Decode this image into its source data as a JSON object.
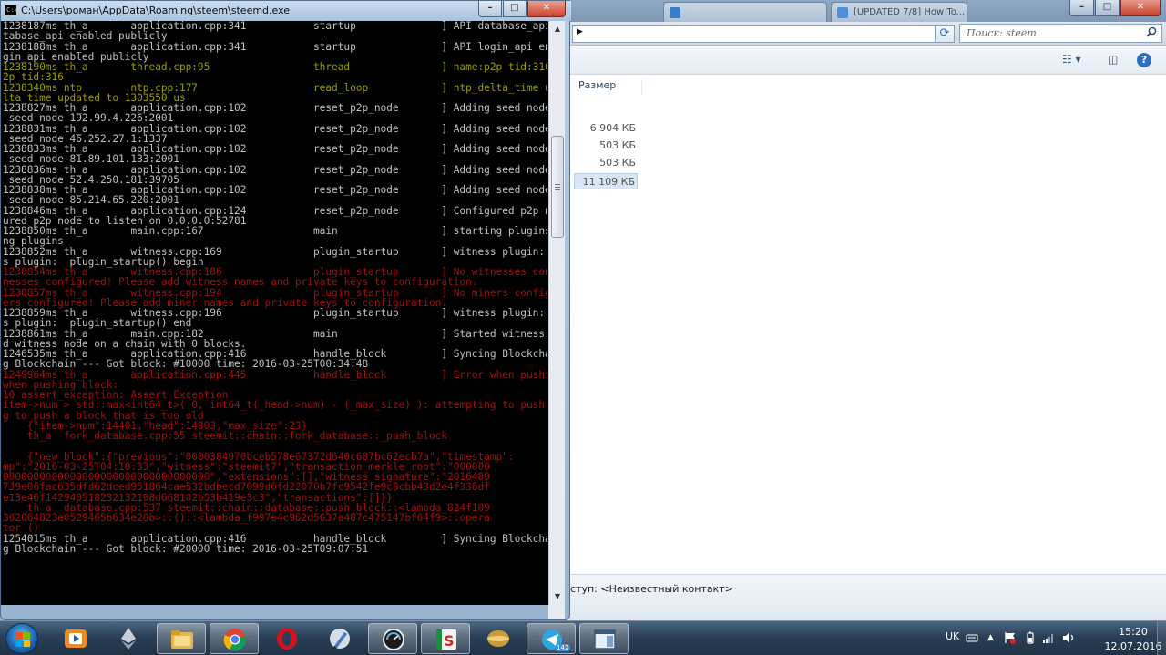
{
  "console": {
    "title": "C:\\Users\\роман\\AppData\\Roaming\\steem\\steemd.exe",
    "buttons": {
      "minimize": "–",
      "maximize": "□",
      "close": "✕"
    },
    "lines": [
      {
        "c": "grey",
        "t": "1238187ms th_a       application.cpp:341           startup              ] API database_api enabled publicly"
      },
      {
        "c": "grey",
        "t": "tabase_api enabled publicly"
      },
      {
        "c": "grey",
        "t": "1238188ms th_a       application.cpp:341           startup              ] API login_api enabled publicly"
      },
      {
        "c": "grey",
        "t": "gin_api enabled publicly"
      },
      {
        "c": "yellow",
        "t": "1238190ms th_a       thread.cpp:95                 thread               ] name:p2p tid:316"
      },
      {
        "c": "yellow",
        "t": "2p tid:316"
      },
      {
        "c": "yellow",
        "t": "1238340ms ntp        ntp.cpp:177                   read_loop            ] ntp_delta_time updated to 1303550 us"
      },
      {
        "c": "yellow",
        "t": "lta_time updated to 1303550 us"
      },
      {
        "c": "grey",
        "t": "1238827ms th_a       application.cpp:102           reset_p2p_node       ] Adding seed node 192.99.4.226:2001"
      },
      {
        "c": "grey",
        "t": " seed node 192.99.4.226:2001"
      },
      {
        "c": "grey",
        "t": "1238831ms th_a       application.cpp:102           reset_p2p_node       ] Adding seed node 46.252.27.1:1337"
      },
      {
        "c": "grey",
        "t": " seed node 46.252.27.1:1337"
      },
      {
        "c": "grey",
        "t": "1238833ms th_a       application.cpp:102           reset_p2p_node       ] Adding seed node 81.89.101.133:2001"
      },
      {
        "c": "grey",
        "t": " seed node 81.89.101.133:2001"
      },
      {
        "c": "grey",
        "t": "1238836ms th_a       application.cpp:102           reset_p2p_node       ] Adding seed node 52.4.250.181:39705"
      },
      {
        "c": "grey",
        "t": " seed node 52.4.250.181:39705"
      },
      {
        "c": "grey",
        "t": "1238838ms th_a       application.cpp:102           reset_p2p_node       ] Adding seed node 85.214.65.220:2001"
      },
      {
        "c": "grey",
        "t": " seed node 85.214.65.220:2001"
      },
      {
        "c": "grey",
        "t": "1238846ms th_a       application.cpp:124           reset_p2p_node       ] Configured p2p node to listen on 0.0.0.0:52781"
      },
      {
        "c": "grey",
        "t": "ured p2p node to listen on 0.0.0.0:52781"
      },
      {
        "c": "grey",
        "t": "1238850ms th_a       main.cpp:167                  main                 ] starting plugins"
      },
      {
        "c": "grey",
        "t": "ng plugins"
      },
      {
        "c": "grey",
        "t": "1238852ms th_a       witness.cpp:169               plugin_startup       ] witness plugin:  plugin_startup() begin"
      },
      {
        "c": "grey",
        "t": "s plugin:  plugin_startup() begin"
      },
      {
        "c": "red",
        "t": "1238854ms th_a       witness.cpp:186               plugin_startup       ] No witnesses configured! Please add witness names and private keys to configuration."
      },
      {
        "c": "red",
        "t": "nesses configured! Please add witness names and private keys to configuration."
      },
      {
        "c": "red",
        "t": "1238857ms th_a       witness.cpp:194               plugin_startup       ] No miners configured! Please add miner names and private keys to configuration."
      },
      {
        "c": "red",
        "t": "ers configured! Please add miner names and private keys to configuration."
      },
      {
        "c": "grey",
        "t": "1238859ms th_a       witness.cpp:196               plugin_startup       ] witness plugin:  plugin_startup() end"
      },
      {
        "c": "grey",
        "t": "s plugin:  plugin_startup() end"
      },
      {
        "c": "grey",
        "t": "1238861ms th_a       main.cpp:182                  main                 ] Started witness node on a chain with 0 blocks."
      },
      {
        "c": "grey",
        "t": "d witness node on a chain with 0 blocks."
      },
      {
        "c": "grey",
        "t": "1246535ms th_a       application.cpp:416           handle_block         ] Syncing Blockchain --- Got block: #10000 time: 2016-03-25T00:34:48"
      },
      {
        "c": "grey",
        "t": "g Blockchain --- Got block: #10000 time: 2016-03-25T00:34:48"
      },
      {
        "c": "red",
        "t": "1249964ms th_a       application.cpp:445           handle_block         ] Error when pushing block:"
      },
      {
        "c": "red",
        "t": "when pushing block:"
      },
      {
        "c": "red",
        "t": "10 assert_exception: Assert Exception"
      },
      {
        "c": "red",
        "t": "item->num > std::max<int64_t>( 0, int64_t(_head->num) - (_max_size) ): attempting to push a block that is too old"
      },
      {
        "c": "red",
        "t": "g to push a block that is too old"
      },
      {
        "c": "red",
        "t": "    {\"item->num\":14401,\"head\":14803,\"max_size\":23}"
      },
      {
        "c": "red",
        "t": "    th_a  fork_database.cpp:55 steemit::chain::fork_database::_push_block"
      },
      {
        "c": "red",
        "t": ""
      },
      {
        "c": "red",
        "t": "    {\"new_block\":{\"previous\":\"0000384070bceb578e67372d640c687bc62ecb7a\",\"timestamp\":"
      },
      {
        "c": "red",
        "t": "mp\":\"2016-03-25T04:18:33\",\"witness\":\"steemit7\",\"transaction_merkle_root\":\"000000"
      },
      {
        "c": "red",
        "t": "0000000000000000000000000000000000\",\"extensions\":[],\"witness_signature\":\"2016489"
      },
      {
        "c": "red",
        "t": "7J9e06fac635dfd62dced951864cae532bdbecd7099d6fd22070b7fc9542fe9c8cbb43d2e4f336df"
      },
      {
        "c": "red",
        "t": "e13e46f142940518232132108d668102b53b419e3c3\",\"transactions\":[]}}"
      },
      {
        "c": "red",
        "t": "    th_a  database.cpp:537 steemit::chain::database::push_block::<lambda_824f109"
      },
      {
        "c": "red",
        "t": "362064823e0529465b634e20b>::()::<lambda_f997e4c962d5637a487c475147bf64f9>::opera"
      },
      {
        "c": "red",
        "t": "tor ()"
      },
      {
        "c": "grey",
        "t": "1254015ms th_a       application.cpp:416           handle_block         ] Syncing Blockchain --- Got block: #20000 time: 2016-03-25T09:07:51"
      },
      {
        "c": "grey",
        "t": "g Blockchain --- Got block: #20000 time: 2016-03-25T09:07:51"
      }
    ]
  },
  "browser": {
    "tab1": "",
    "tab2": "[UPDATED 7/8] How To...",
    "buttons": {
      "minimize": "–",
      "maximize": "□",
      "close": "✕"
    }
  },
  "explorer": {
    "search_placeholder": "Поиск: steem",
    "column_header": "Размер",
    "file_sizes": [
      "6 904 КБ",
      "503 КБ",
      "503 КБ",
      "11 109 КБ"
    ],
    "selected_index": 3,
    "status_text": "ступ:  <Неизвестный контакт>"
  },
  "taskbar": {
    "apps": [
      "media-player",
      "ethereum-wallet",
      "file-explorer",
      "chrome",
      "opera",
      "pen-tool",
      "clock-app",
      "spreadsheet-app",
      "steem-app",
      "telegram",
      "window-app"
    ],
    "telegram_badge": "142",
    "language": "UK",
    "time": "15:20",
    "date": "12.07.2016"
  },
  "colors": {
    "console_bg": "#000000",
    "console_text": "#c0c0c0",
    "console_warn": "#9c9c00",
    "console_error": "#a01010",
    "taskbar": "#2a3f56"
  }
}
